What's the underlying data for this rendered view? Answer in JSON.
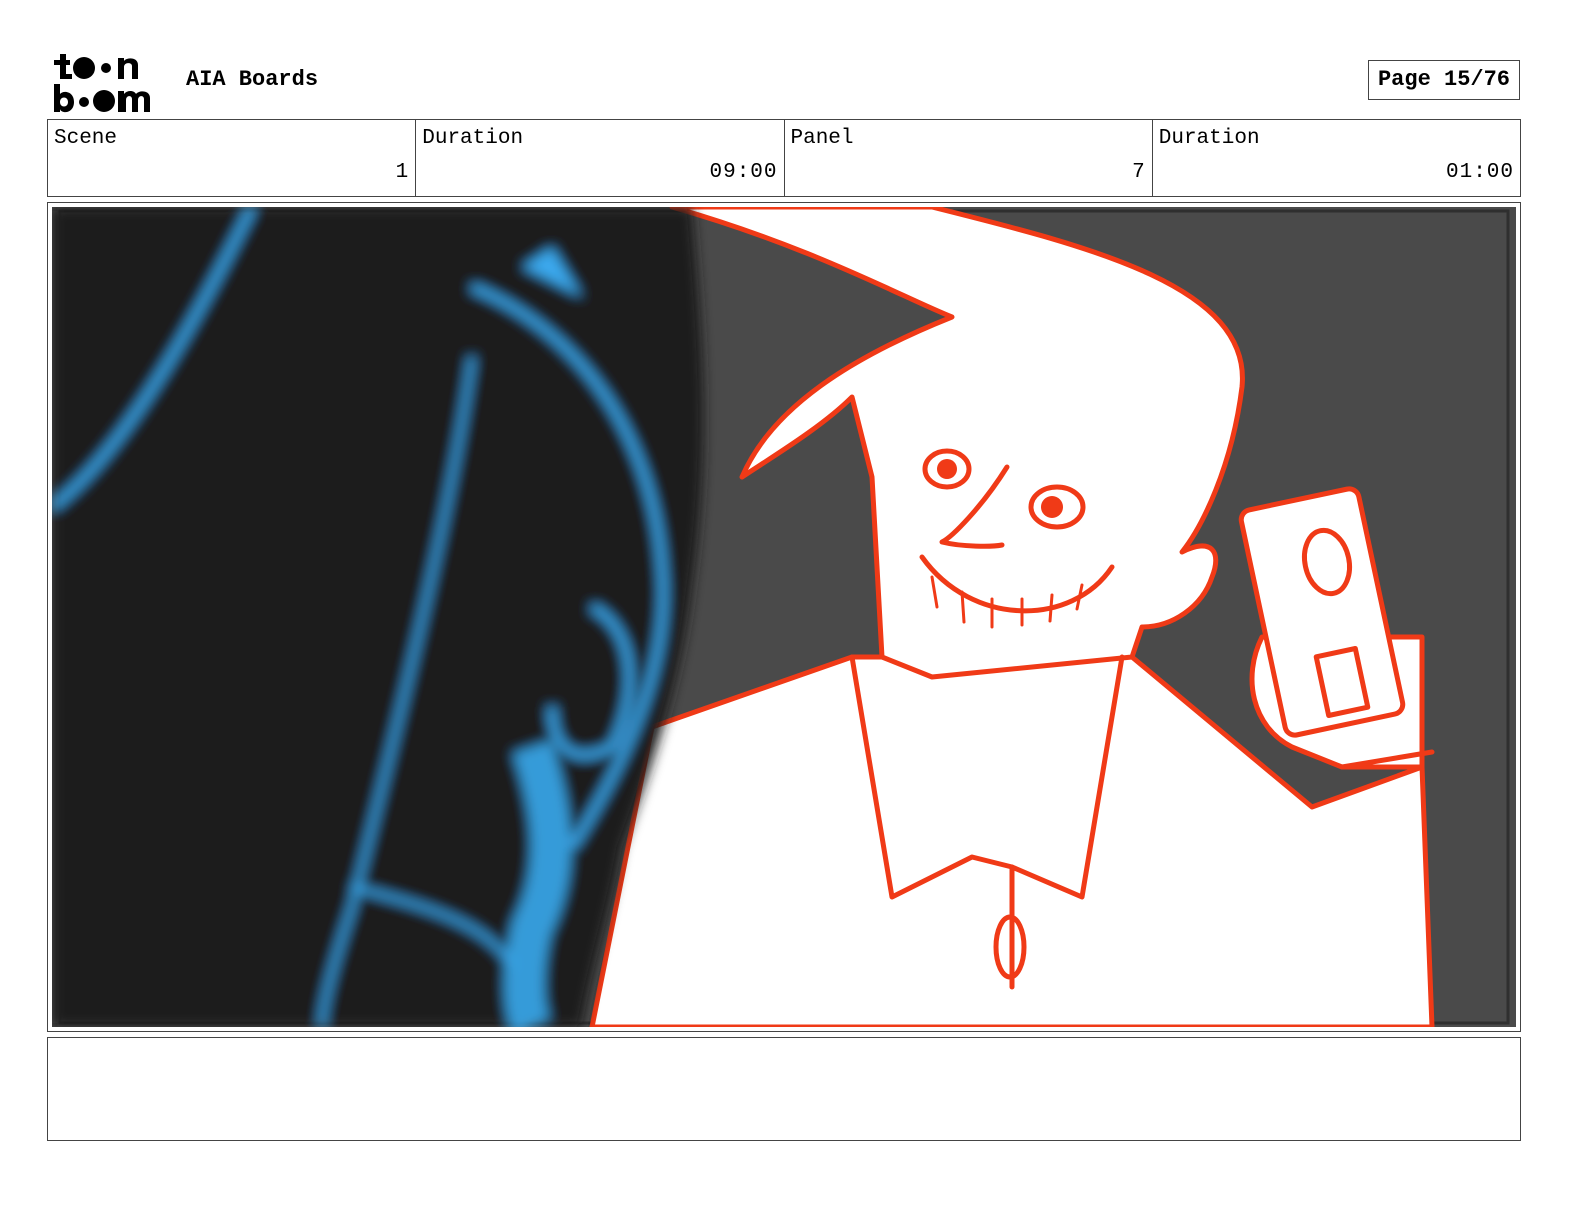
{
  "header": {
    "logo_text_top": "toon",
    "logo_text_bottom": "boom",
    "project_title": "AIA Boards",
    "page_indicator": "Page 15/76"
  },
  "info": [
    {
      "label": "Scene",
      "value": "1"
    },
    {
      "label": "Duration",
      "value": "09:00"
    },
    {
      "label": "Panel",
      "value": "7"
    },
    {
      "label": "Duration",
      "value": "01:00"
    }
  ],
  "panel": {
    "colors": {
      "background": "#4a4a4a",
      "foreground_figure": "#1b1b1b",
      "foreground_line": "#3aa9ee",
      "character_fill": "#ffffff",
      "character_line": "#f03a17"
    }
  },
  "caption": {
    "text": ""
  }
}
